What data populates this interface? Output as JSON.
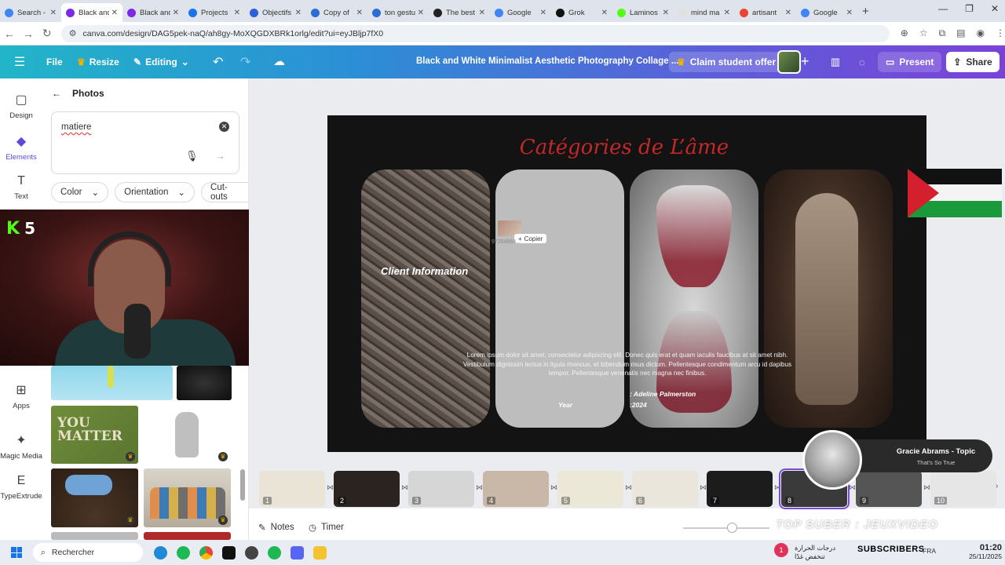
{
  "browser": {
    "tabs": [
      {
        "label": "Search -",
        "color": "#4285f4",
        "active": false
      },
      {
        "label": "Black and",
        "color": "#7d2ae8",
        "active": true
      },
      {
        "label": "Black and",
        "color": "#7d2ae8",
        "active": false
      },
      {
        "label": "Projects",
        "color": "#1a73e8",
        "active": false
      },
      {
        "label": "Objectifs",
        "color": "#2d5fd6",
        "active": false
      },
      {
        "label": "Copy of",
        "color": "#2b6cd6",
        "active": false
      },
      {
        "label": "ton gestu",
        "color": "#2b6cd6",
        "active": false
      },
      {
        "label": "The best",
        "color": "#222222",
        "active": false
      },
      {
        "label": "Google",
        "color": "#4285f4",
        "active": false
      },
      {
        "label": "Grok",
        "color": "#111111",
        "active": false
      },
      {
        "label": "Laminos",
        "color": "#53fc18",
        "active": false
      },
      {
        "label": "mind ma",
        "color": "#e0e0e0",
        "active": false
      },
      {
        "label": "artisant",
        "color": "#ea4335",
        "active": false
      },
      {
        "label": "Google",
        "color": "#4285f4",
        "active": false
      }
    ],
    "url": "canva.com/design/DAG5pek-naQ/ah8gy-MoXQGDXBRk1orlg/edit?ui=eyJBljp7fX0"
  },
  "topbar": {
    "file": "File",
    "resize": "Resize",
    "editing": "Editing",
    "title": "Black and White Minimalist Aesthetic Photography Collage ...",
    "claim": "Claim student offer",
    "present": "Present",
    "share": "Share"
  },
  "rail": {
    "design": "Design",
    "elements": "Elements",
    "text": "Text",
    "apps": "Apps",
    "magic_media": "Magic Media",
    "typeextrude": "TypeExtrude"
  },
  "panel": {
    "header": "Photos",
    "search_value": "matiere",
    "filters": [
      "Color",
      "Orientation",
      "Cut-outs"
    ]
  },
  "webcam": {
    "platform": "K",
    "count": "5"
  },
  "slide": {
    "title": "Catégories de L’âme",
    "client_info": "Client Information",
    "lorem": "Lorem ipsum dolor sit amet, consectetur adipiscing elit. Donec quis erat et quam iaculis faucibus at sit amet nibh. Vestibulum dignissim lectus in ligula rhoncus, et bibendum risus dictum. Pellentesque condimentum arcu id dapibus tempor. Pellentesque venenatis nec magna nec finibus.",
    "year_label": "Year",
    "author": ": Adeline Palmerston",
    "date": ":2024",
    "copier": "Copier",
    "drag_id": "97204564..."
  },
  "music": {
    "title": "Gracie Abrams - Topic",
    "subtitle": "That's So True"
  },
  "pages": [
    "1",
    "2",
    "3",
    "4",
    "5",
    "6",
    "7",
    "8",
    "9",
    "10"
  ],
  "selected_page": "8",
  "bottombar": {
    "notes": "Notes",
    "timer": "Timer",
    "overlay": "TOP SUBER : JEUXVIDEO"
  },
  "taskbar": {
    "search": "Rechercher",
    "notif": "1",
    "temp": "درجات الحرارة تنخفض غدًا",
    "subscribers": "SUBSCRIBERS",
    "lang": "FRA",
    "time": "01:20",
    "date": "25/11/2025"
  },
  "colors": {
    "accent": "#7d2ae8",
    "title_red": "#c22828"
  }
}
